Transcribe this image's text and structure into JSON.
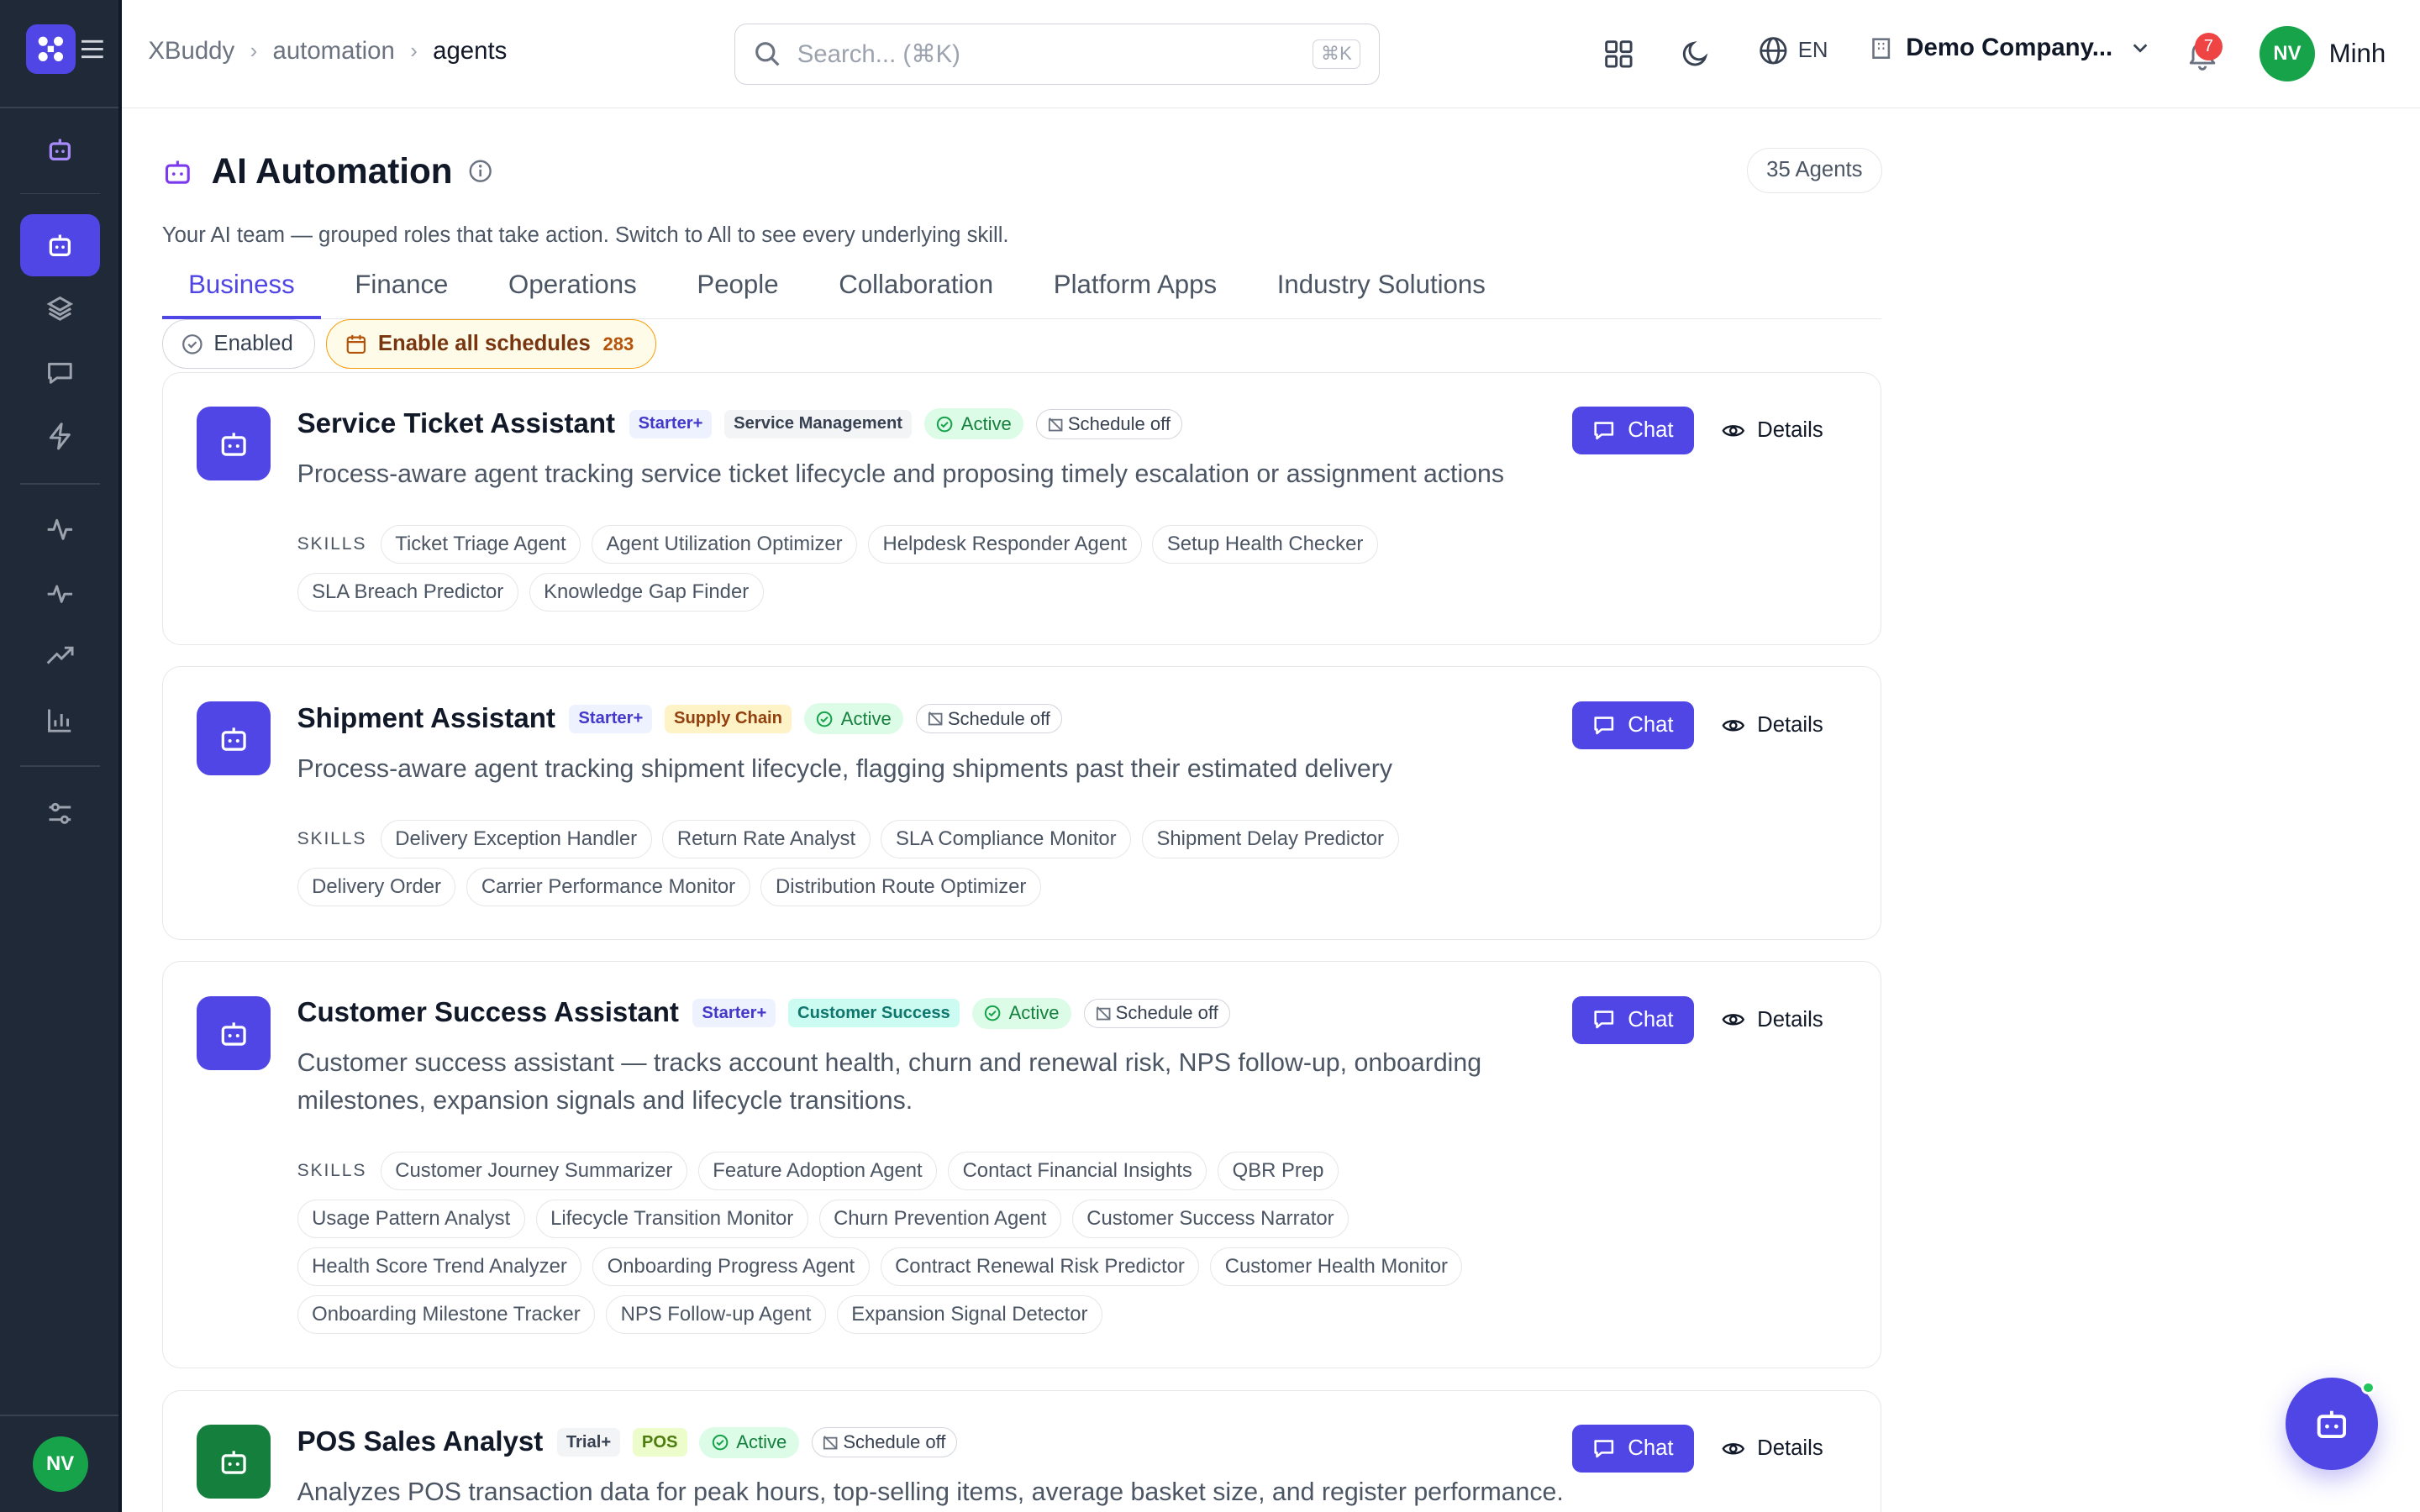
{
  "header": {
    "breadcrumb": [
      "XBuddy",
      "automation",
      "agents"
    ],
    "search_placeholder": "Search... (⌘K)",
    "search_kbd": "⌘K",
    "language": "EN",
    "company": "Demo Company...",
    "notif_count": "7",
    "user_initials": "NV",
    "user_name": "Minh"
  },
  "sidebar": {
    "user_initials": "NV",
    "items": [
      "agent-robot",
      "automation",
      "layers",
      "chat",
      "lightning",
      "activity",
      "pulse",
      "trending",
      "bar-chart",
      "settings-sliders"
    ]
  },
  "page": {
    "title": "AI Automation",
    "agent_count": "35 Agents",
    "subtitle": "Your AI team — grouped roles that take action. Switch to All to see every underlying skill.",
    "tabs": [
      "Business",
      "Finance",
      "Operations",
      "People",
      "Collaboration",
      "Platform Apps",
      "Industry Solutions"
    ],
    "filters": {
      "enabled": "Enabled",
      "enable_all": "Enable all schedules",
      "enable_all_count": "283"
    }
  },
  "labels": {
    "skills": "SKILLS",
    "chat": "Chat",
    "details": "Details",
    "active": "Active",
    "schedule_off": "Schedule off"
  },
  "agents": [
    {
      "name": "Service Ticket Assistant",
      "tier": "Starter+",
      "category": "Service Management",
      "description": "Process-aware agent tracking service ticket lifecycle and proposing timely escalation or assignment actions",
      "skills": [
        "Ticket Triage Agent",
        "Agent Utilization Optimizer",
        "Helpdesk Responder Agent",
        "Setup Health Checker",
        "SLA Breach Predictor",
        "Knowledge Gap Finder"
      ]
    },
    {
      "name": "Shipment Assistant",
      "tier": "Starter+",
      "category": "Supply Chain",
      "description": "Process-aware agent tracking shipment lifecycle, flagging shipments past their estimated delivery",
      "skills": [
        "Delivery Exception Handler",
        "Return Rate Analyst",
        "SLA Compliance Monitor",
        "Shipment Delay Predictor",
        "Delivery Order",
        "Carrier Performance Monitor",
        "Distribution Route Optimizer"
      ]
    },
    {
      "name": "Customer Success Assistant",
      "tier": "Starter+",
      "category": "Customer Success",
      "description": "Customer success assistant — tracks account health, churn and renewal risk, NPS follow-up, onboarding milestones, expansion signals and lifecycle transitions.",
      "skills": [
        "Customer Journey Summarizer",
        "Feature Adoption Agent",
        "Contact Financial Insights",
        "QBR Prep",
        "Usage Pattern Analyst",
        "Lifecycle Transition Monitor",
        "Churn Prevention Agent",
        "Customer Success Narrator",
        "Health Score Trend Analyzer",
        "Onboarding Progress Agent",
        "Contract Renewal Risk Predictor",
        "Customer Health Monitor",
        "Onboarding Milestone Tracker",
        "NPS Follow-up Agent",
        "Expansion Signal Detector"
      ]
    },
    {
      "name": "POS Sales Analyst",
      "tier": "Trial+",
      "category": "POS",
      "description": "Analyzes POS transaction data for peak hours, top-selling items, average basket size, and register performance."
    }
  ],
  "colors": {
    "accent": "#4f46e5",
    "sidebar": "#1f2937",
    "active_green": "#16a34a"
  }
}
